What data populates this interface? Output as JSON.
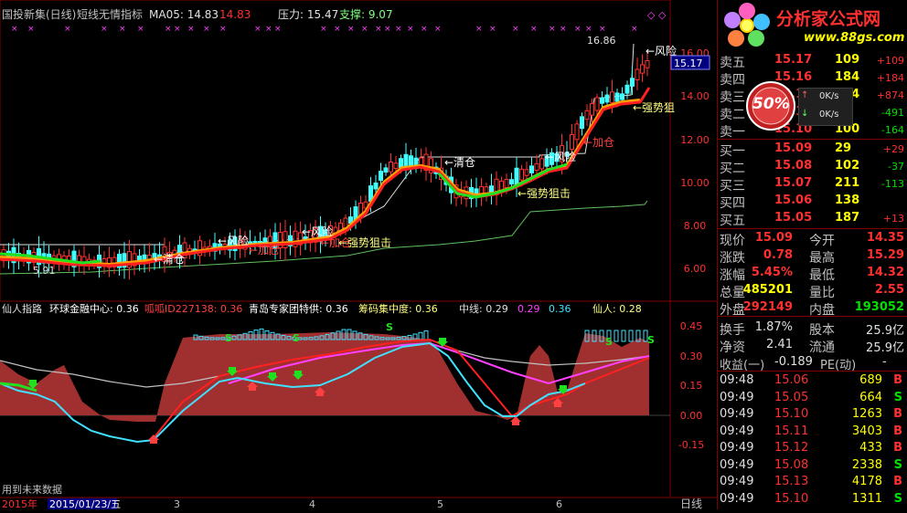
{
  "title": {
    "name": "国投新集(日线)",
    "indicator": "短线无情指标",
    "ma_label": "MA05: 14.83",
    "ma_value2": "14.83",
    "pressure": "压力: 15.47",
    "support": "支撑: 9.07"
  },
  "top_chart": {
    "price_axis": [
      "16.00",
      "14.00",
      "12.00",
      "10.00",
      "8.00",
      "6.00"
    ],
    "current_price_tag": "15.17",
    "high_label": "16.86",
    "low_label": "5.91",
    "annotations": [
      "←风险",
      "←强势狙",
      "←加仓",
      "←清仓",
      "←风险",
      "←强势狙击",
      "←风险",
      "←加仓",
      "←强势狙击",
      "←风险",
      "←加仓",
      "←清仓"
    ]
  },
  "sub_chart": {
    "header": {
      "name": "仙人指路",
      "hk": "环球金融中心: 0.36",
      "id": "呱呱ID227138: 0.36",
      "qd": "青岛专家团特供: 0.36",
      "ch": "筹码集中度: 0.36",
      "mid": "中线: 0.29",
      "v2": "0.29",
      "v3": "0.36",
      "xr": "仙人: 0.28"
    },
    "axis": [
      "0.45",
      "0.30",
      "0.15",
      "0.00",
      "-0.15"
    ]
  },
  "bottom": {
    "future_data": "用到未来数据",
    "year": "2015年",
    "date_box": "2015/01/23/五",
    "months": [
      "3",
      "4",
      "5",
      "6"
    ],
    "period_button": "日线"
  },
  "logo": {
    "text": "分析家公式网",
    "url": "www.88gs.com",
    "pct": "50%",
    "speed1": "0K/s",
    "speed2": "0K/s"
  },
  "order_book": {
    "asks": [
      {
        "label": "卖五",
        "price": "15.17",
        "vol": "109",
        "chg": "+109"
      },
      {
        "label": "卖四",
        "price": "15.16",
        "vol": "184",
        "chg": "+184"
      },
      {
        "label": "卖三",
        "price": "15.15",
        "vol": "874",
        "chg": "+874"
      },
      {
        "label": "卖二",
        "price": "15.11",
        "vol": "49",
        "chg": "-491"
      },
      {
        "label": "卖一",
        "price": "15.10",
        "vol": "100",
        "chg": "-164"
      }
    ],
    "bids": [
      {
        "label": "买一",
        "price": "15.09",
        "vol": "29",
        "chg": "+29"
      },
      {
        "label": "买二",
        "price": "15.08",
        "vol": "102",
        "chg": "-37"
      },
      {
        "label": "买三",
        "price": "15.07",
        "vol": "211",
        "chg": "-113"
      },
      {
        "label": "买四",
        "price": "15.06",
        "vol": "138",
        "chg": ""
      },
      {
        "label": "买五",
        "price": "15.05",
        "vol": "187",
        "chg": "+13"
      }
    ]
  },
  "quote": {
    "rows": [
      {
        "l1": "现价",
        "v1": "15.09",
        "l2": "今开",
        "v2": "14.35",
        "c1": "red",
        "c2": "red"
      },
      {
        "l1": "涨跌",
        "v1": "0.78",
        "l2": "最高",
        "v2": "15.29",
        "c1": "red",
        "c2": "red"
      },
      {
        "l1": "涨幅",
        "v1": "5.45%",
        "l2": "最低",
        "v2": "14.32",
        "c1": "red",
        "c2": "red"
      },
      {
        "l1": "总量",
        "v1": "485201",
        "l2": "量比",
        "v2": "2.55",
        "c1": "yel",
        "c2": "red"
      },
      {
        "l1": "外盘",
        "v1": "292149",
        "l2": "内盘",
        "v2": "193052",
        "c1": "red",
        "c2": "grn"
      }
    ],
    "rows2": [
      {
        "l1": "换手",
        "v1": "1.87%",
        "l2": "股本",
        "v2": "25.9亿"
      },
      {
        "l1": "净资",
        "v1": "2.41",
        "l2": "流通",
        "v2": "25.9亿"
      }
    ],
    "profit_label": "收益(一)",
    "profit_value": "-0.189",
    "pe_label": "PE(动)",
    "pe_value": "-"
  },
  "ticks": [
    {
      "time": "09:48",
      "price": "15.06",
      "vol": "689",
      "side": "B"
    },
    {
      "time": "09:49",
      "price": "15.05",
      "vol": "664",
      "side": "S"
    },
    {
      "time": "09:49",
      "price": "15.10",
      "vol": "1263",
      "side": "B"
    },
    {
      "time": "09:49",
      "price": "15.11",
      "vol": "3403",
      "side": "B"
    },
    {
      "time": "09:49",
      "price": "15.12",
      "vol": "433",
      "side": "B"
    },
    {
      "time": "09:49",
      "price": "15.08",
      "vol": "2338",
      "side": "S"
    },
    {
      "time": "09:49",
      "price": "15.13",
      "vol": "4178",
      "side": "B"
    },
    {
      "time": "09:49",
      "price": "15.10",
      "vol": "1311",
      "side": "S"
    }
  ]
}
